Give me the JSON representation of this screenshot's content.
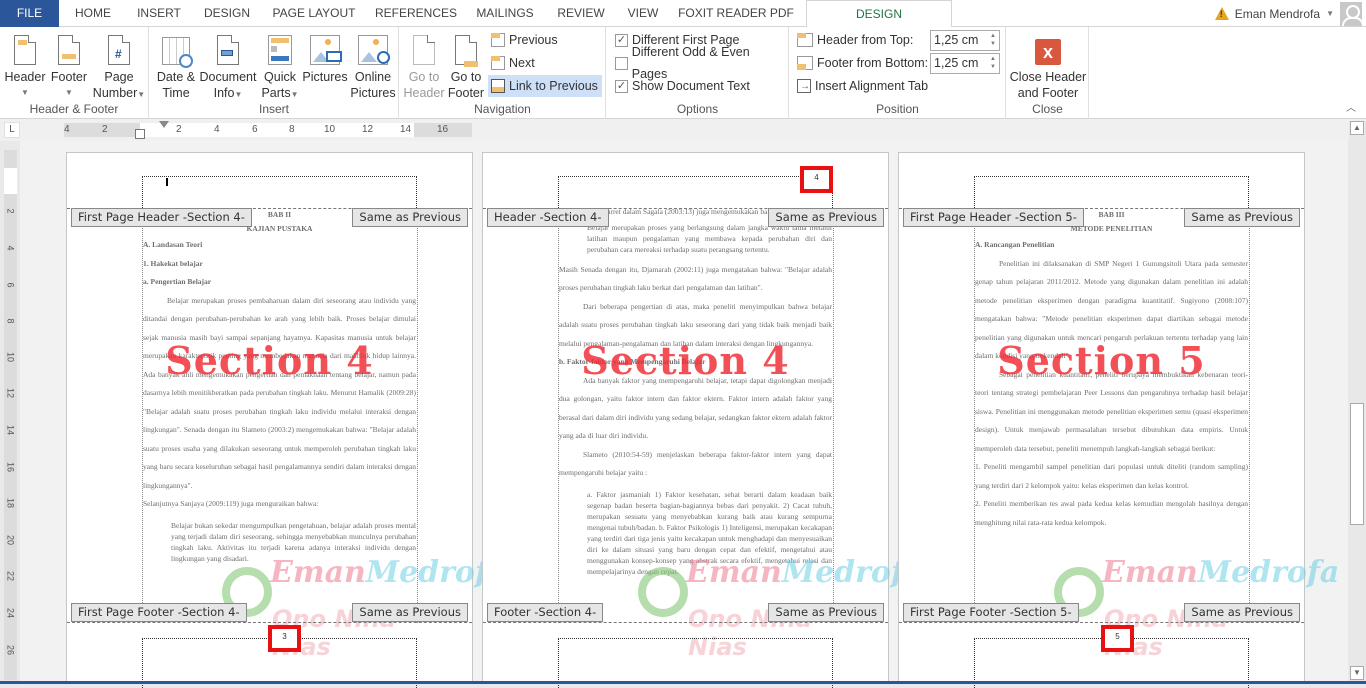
{
  "tabs": {
    "file": "FILE",
    "items": [
      "HOME",
      "INSERT",
      "DESIGN",
      "PAGE LAYOUT",
      "REFERENCES",
      "MAILINGS",
      "REVIEW",
      "VIEW",
      "FOXIT READER PDF"
    ],
    "active": "DESIGN"
  },
  "user": {
    "name": "Eman Mendrofa"
  },
  "ribbon": {
    "header_footer": {
      "label": "Header & Footer",
      "header": "Header",
      "footer": "Footer",
      "page_number_1": "Page",
      "page_number_2": "Number"
    },
    "insert": {
      "label": "Insert",
      "date_time_1": "Date &",
      "date_time_2": "Time",
      "document_info_1": "Document",
      "document_info_2": "Info",
      "quick_parts_1": "Quick",
      "quick_parts_2": "Parts",
      "pictures": "Pictures",
      "online_pictures_1": "Online",
      "online_pictures_2": "Pictures"
    },
    "navigation": {
      "label": "Navigation",
      "goto_header_1": "Go to",
      "goto_header_2": "Header",
      "goto_footer_1": "Go to",
      "goto_footer_2": "Footer",
      "previous": "Previous",
      "next": "Next",
      "link_to_previous": "Link to Previous"
    },
    "options": {
      "label": "Options",
      "different_first_page": "Different First Page",
      "different_first_page_checked": true,
      "different_odd_even": "Different Odd & Even Pages",
      "different_odd_even_checked": false,
      "show_document_text": "Show Document Text",
      "show_document_text_checked": true
    },
    "position": {
      "label": "Position",
      "header_from_top_label": "Header from Top:",
      "header_from_top_value": "1,25 cm",
      "footer_from_bottom_label": "Footer from Bottom:",
      "footer_from_bottom_value": "1,25 cm",
      "insert_alignment_tab": "Insert Alignment Tab"
    },
    "close": {
      "label": "Close",
      "close_1": "Close Header",
      "close_2": "and Footer"
    }
  },
  "ruler": {
    "h_ticks": [
      "4",
      "2",
      "2",
      "4",
      "6",
      "8",
      "10",
      "12",
      "14",
      "16"
    ],
    "v_ticks": [
      "2",
      "4",
      "6",
      "8",
      "10",
      "12",
      "14",
      "16",
      "18",
      "20",
      "22",
      "24",
      "26"
    ],
    "corner": "L"
  },
  "pages": [
    {
      "header_tag": "First Page Header -Section 4-",
      "footer_tag": "First Page Footer -Section 4-",
      "same_as_previous": "Same as Previous",
      "section_label": "Section 4",
      "page_number": "3",
      "lines": [
        {
          "cls": "c",
          "text": "BAB II"
        },
        {
          "cls": "c",
          "text": "KAJIAN PUSTAKA"
        },
        {
          "cls": "",
          "text": " "
        },
        {
          "cls": "b",
          "text": "A.  Landasan Teori"
        },
        {
          "cls": "b",
          "text": "1.  Hakekat belajar"
        },
        {
          "cls": "b",
          "text": "a.  Pengertian Belajar"
        },
        {
          "cls": "ind",
          "text": "Belajar merupakan proses pembaharuan dalam diri seseorang atau individu yang ditandai dengan perubahan-perubahan ke arah yang lebih baik. Proses belajar dimulai sejak manusia masih bayi sampai sepanjang hayatnya. Kapasitas manusia untuk belajar merupakan karakteristik penting yang membedakan manusia dari makhluk hidup lainnya. Ada banyak ahli mengemukakan pengertian dan pemaknaan tentang belajar, namun pada dasarnya lebih menitikberatkan pada perubahan tingkah laku. Menurut Hamalik (2009:28) \"Belajar adalah suatu proses perubahan tingkah laku individu melalui interaksi dengan lingkungan\". Senada dengan itu Slameto (2003:2) mengemukakan bahwa: \"Belajar adalah suatu proses usaha yang dilakukan seseorang untuk memperoleh perubahan tingkah laku yang baru secara keseluruhan sebagai hasil pengalamannya sendiri dalam interaksi dengan lingkungannya\"."
        },
        {
          "cls": "",
          "text": "Selanjutnya Sanjaya (2009:119) juga menguraikan bahwa:"
        },
        {
          "cls": "quote",
          "text": "Belajar bukan sekedar mengumpulkan pengetahuan, belajar adalah proses mental yang terjadi dalam diri seseorang, sehingga menyebabkan munculnya perubahan tingkah laku. Aktivitas itu terjadi karena adanya interaksi individu dengan lingkungan yang disadari."
        }
      ]
    },
    {
      "header_tag": "Header -Section 4-",
      "footer_tag": "Footer -Section 4-",
      "same_as_previous": "Same as Previous",
      "section_label": "Section 4",
      "page_number": "4",
      "lines": [
        {
          "cls": "",
          "text": "Lebih Lanjut, Garret dalam Sagala (2003:13) juga mengemukakan bahwa:"
        },
        {
          "cls": "quote",
          "text": "Belajar merupakan proses yang berlangsung dalam jangka waktu lama melalui latihan maupun pengalaman yang membawa kepada perubahan diri dan perubahan cara mereaksi terhadap suatu perangsang tertentu."
        },
        {
          "cls": "",
          "text": "Masih Senada dengan itu, Djamarah (2002:11) juga mengatakan bahwa: \"Belajar adalah proses perubahan tingkah laku berkat dari pengalaman dan latihan\"."
        },
        {
          "cls": "ind",
          "text": "Dari beberapa pengertian di atas, maka peneliti menyimpulkan bahwa belajar adalah suatu proses perubahan tingkah laku seseorang dari yang tidak baik menjadi baik melalui pengalaman-pengalaman dan latihan dalam interaksi dengan lingkungannya."
        },
        {
          "cls": "b",
          "text": "b.  Faktor-faktor yang Mempengaruhi Belajar"
        },
        {
          "cls": "ind",
          "text": "Ada banyak faktor yang mempengaruhi belajar, tetapi dapat digolongkan menjadi dua golongan, yaitu faktor intern dan faktor ektern. Faktor intern adalah faktor yang berasal dari dalam diri individu yang sedang belajar, sedangkan faktor ektern adalah faktor yang ada di luar diri individu."
        },
        {
          "cls": "ind",
          "text": "Slameto (2010:54-59) menjelaskan beberapa faktor-faktor intern yang dapat mempengaruhi belajar yaitu :"
        },
        {
          "cls": "quote",
          "text": "a. Faktor jasmaniah 1) Faktor kesehatan, sehat berarti dalam keadaan baik segenap badan beserta bagian-bagiannya bebas dari penyakit. 2) Cacat tubuh, merupakan sesuatu yang menyebabkan kurang baik atau kurang sempurna mengenai tubuh/badan. b. Faktor Psikologis 1) Inteligensi, merupakan kecakapan yang terdiri dari tiga jenis yaitu kecakapan untuk menghadapi dan menyesuaikan diri ke dalam situasi yang baru dengan cepat dan efektif, mengetahui atau menggunakan konsep-konsep yang abstrak secara efektif, mengetahui relasi dan mempelajarinya dengan cepat."
        }
      ]
    },
    {
      "header_tag": "First Page Header -Section 5-",
      "footer_tag": "First Page Footer -Section 5-",
      "same_as_previous": "Same as Previous",
      "section_label": "Section 5",
      "page_number": "5",
      "lines": [
        {
          "cls": "c",
          "text": "BAB III"
        },
        {
          "cls": "c",
          "text": "METODE PENELITIAN"
        },
        {
          "cls": "",
          "text": " "
        },
        {
          "cls": "b",
          "text": "A.  Rancangan Penelitian"
        },
        {
          "cls": "ind",
          "text": "Penelitian ini dilaksanakan di SMP Negeri 1 Gunungsitoli Utara pada semester genap tahun pelajaran 2011/2012. Metode yang digunakan dalam penelitian ini adalah metode penelitian eksperimen dengan paradigma kuantitatif. Sugiyono (2008:107) mengatakan bahwa: \"Metode penelitian eksperimen dapat diartikan sebagai metode penelitian yang digunakan untuk mencari pengaruh perlakuan tertentu terhadap yang lain dalam kondisi yang terkendali\"."
        },
        {
          "cls": "ind",
          "text": "Sebagai penelitian kuantitatif, peneliti berupaya membuktikan kebenaran teori-teori tentang strategi pembelajaran Peer Lessons dan pengaruhnya terhadap hasil belajar siswa. Penelitian ini menggunakan metode penelitian eksperimen semu (quasi eksperimen design). Untuk menjawab permasalahan tersebut dibutuhkan data empiris. Untuk memperoleh data tersebut, peneliti menempuh langkah-langkah sebagai berikut:"
        },
        {
          "cls": "",
          "text": "1.  Peneliti mengambil sampel penelitian dari populasi untuk diteliti (random sampling) yang terdiri dari 2 kelompok yaitu: kelas eksperimen dan kelas kontrol."
        },
        {
          "cls": "",
          "text": "2.  Peneliti memberikan tes awal pada kedua kelas kemudian mengolah hasilnya dengan menghitung nilai rata-rata kedua kelompok."
        }
      ]
    }
  ],
  "watermark": {
    "line1a": "Eman",
    "line1b": "Medrofa",
    "line2": "Ono Niha - Nias"
  },
  "colors": {
    "file_tab": "#2b579a",
    "active_tab_text": "#217346",
    "section_label": "#f02832",
    "highlight_box": "#e81010",
    "close_icon": "#d9573e"
  }
}
